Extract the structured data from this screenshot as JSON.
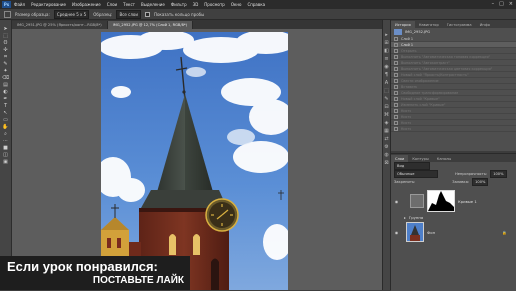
{
  "app": {
    "logo": "Ps",
    "menu": [
      "Файл",
      "Редактирование",
      "Изображение",
      "Слои",
      "Текст",
      "Выделение",
      "Фильтр",
      "3D",
      "Просмотр",
      "Окно",
      "Справка"
    ],
    "window_buttons": [
      "–",
      "□",
      "×"
    ]
  },
  "options": {
    "size_label": "Размер образца:",
    "size_value": "Среднее 5 х 5",
    "sample_label": "Образец:",
    "sample_value": "Все слои",
    "ring_label": "Показать кольцо пробы"
  },
  "tabs": [
    {
      "label": "IMG_2951.JPG @ 25% (Яркость/конт...RGB/8*)",
      "active": false
    },
    {
      "label": "IMG_2952.JPG @ 12,7% (Слой 1, RGB/8*)",
      "active": true
    }
  ],
  "tools": [
    "➤",
    "⬚",
    "ʘ",
    "✣",
    "⌗",
    "✎",
    "✦",
    "⌫",
    "▤",
    "◐",
    "✒",
    "T",
    "↖",
    "▭",
    "✋",
    "⌕",
    "⋯",
    "■",
    "◫",
    "▣"
  ],
  "panel_icons": [
    "▸",
    "⊞",
    "◧",
    "≡",
    "◉",
    "¶",
    "A",
    "⬚",
    "✎",
    "⊟",
    "⌘",
    "◈",
    "▦",
    "⇄",
    "⚙",
    "◍",
    "⊠"
  ],
  "history_panel": {
    "tabs": [
      "История",
      "Навигатор",
      "Гистограмма",
      "Инфо"
    ],
    "snapshot": "IMG_2952.JPG",
    "items": [
      {
        "label": "Слой 1",
        "state": "done"
      },
      {
        "label": "Слой 1",
        "state": "active"
      },
      {
        "label": "Открыть",
        "state": "undone"
      },
      {
        "label": "Выполнить \"Автоматическая тоновая коррекция\"",
        "state": "undone"
      },
      {
        "label": "Выполнить \"Автоконтраст\"",
        "state": "undone"
      },
      {
        "label": "Выполнить \"Автоматическая цветовая коррекция\"",
        "state": "undone"
      },
      {
        "label": "Новый слой \"Яркость/Контрастность\"",
        "state": "undone"
      },
      {
        "label": "Свести изображение",
        "state": "undone"
      },
      {
        "label": "Вставить",
        "state": "undone"
      },
      {
        "label": "Свободное трансформирование",
        "state": "undone"
      },
      {
        "label": "Новый слой \"Кривые\"",
        "state": "undone"
      },
      {
        "label": "Изменить слой \"Кривые\"",
        "state": "undone"
      },
      {
        "label": "Кисть",
        "state": "undone"
      },
      {
        "label": "Кисть",
        "state": "undone"
      },
      {
        "label": "Кисть",
        "state": "undone"
      },
      {
        "label": "Кисть",
        "state": "undone"
      }
    ]
  },
  "layers_panel": {
    "tabs": [
      "Слои",
      "Контуры",
      "Каналы"
    ],
    "kind_label": "Вид",
    "blend_mode": "Обычные",
    "opacity_label": "Непрозрачность:",
    "opacity_value": "100%",
    "lock_label": "Закрепить:",
    "fill_label": "Заливка:",
    "fill_value": "100%",
    "layers": [
      {
        "name": "Кривые 1",
        "has_mask": true
      },
      {
        "name": "Группа",
        "sub": true
      },
      {
        "name": "Фон",
        "locked": true
      }
    ]
  },
  "caption": {
    "line1": "Если урок понравился:",
    "line2": "ПОСТАВЬТЕ ЛАЙК"
  }
}
